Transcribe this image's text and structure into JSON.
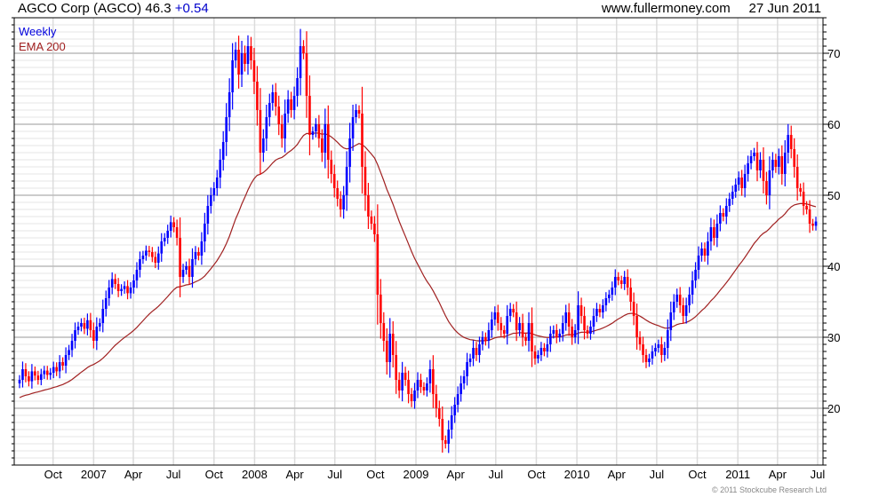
{
  "header": {
    "company": "AGCO Corp (AGCO)",
    "price": "46.3",
    "change": "+0.54",
    "site": "www.fullermoney.com",
    "date": "27 Jun 2011"
  },
  "legend": {
    "weekly": "Weekly",
    "ema": "EMA 200"
  },
  "copyright": "© 2011 Stockcube Research Ltd",
  "colors": {
    "up": "#0000ff",
    "down": "#ff0000",
    "ema": "#a02020",
    "grid_major": "#bbbbbb",
    "grid_minor": "#e4e4e4"
  },
  "chart_data": {
    "type": "candlestick",
    "frequency": "weekly",
    "first_week": "2006-07-17",
    "last_week": "2011-06-27",
    "ylim": [
      12,
      75
    ],
    "y_ticks": [
      20,
      30,
      40,
      50,
      60,
      70
    ],
    "x_ticks": [
      "Oct",
      "2007",
      "Apr",
      "Jul",
      "Oct",
      "2008",
      "Apr",
      "Jul",
      "Oct",
      "2009",
      "Apr",
      "Jul",
      "Oct",
      "2010",
      "Apr",
      "Jul",
      "Oct",
      "2011",
      "Apr",
      "Jul"
    ],
    "x_tick_dates": [
      "2006-10",
      "2007-01",
      "2007-04",
      "2007-07",
      "2007-10",
      "2008-01",
      "2008-04",
      "2008-07",
      "2008-10",
      "2009-01",
      "2009-04",
      "2009-07",
      "2009-10",
      "2010-01",
      "2010-04",
      "2010-07",
      "2010-10",
      "2011-01",
      "2011-04",
      "2011-07"
    ],
    "grid": true,
    "legend_position": "top-left",
    "ema_period": 200,
    "ema_start": 21.5,
    "closes": [
      24.0,
      25.5,
      24.5,
      23.8,
      25.2,
      24.6,
      24.0,
      24.8,
      25.3,
      24.7,
      25.0,
      25.8,
      25.2,
      26.5,
      26.0,
      27.5,
      28.2,
      29.5,
      31.0,
      31.5,
      32.0,
      31.2,
      32.4,
      31.0,
      29.5,
      31.5,
      32.0,
      34.0,
      35.5,
      37.0,
      38.2,
      37.5,
      36.5,
      36.8,
      37.2,
      36.2,
      37.0,
      38.0,
      39.5,
      41.0,
      41.5,
      42.2,
      42.0,
      41.3,
      40.5,
      41.8,
      43.5,
      44.0,
      45.0,
      46.2,
      45.5,
      44.0,
      38.5,
      39.5,
      40.0,
      38.5,
      41.0,
      42.0,
      41.5,
      43.5,
      46.0,
      48.5,
      50.0,
      51.0,
      52.5,
      55.0,
      57.5,
      61.0,
      64.5,
      69.0,
      70.5,
      67.0,
      70.0,
      68.5,
      71.0,
      69.0,
      66.0,
      62.0,
      56.0,
      58.0,
      61.0,
      63.0,
      64.5,
      62.5,
      60.0,
      58.0,
      61.5,
      63.5,
      62.0,
      64.0,
      66.5,
      71.0,
      70.0,
      64.0,
      58.5,
      59.0,
      60.0,
      58.0,
      56.0,
      60.0,
      55.0,
      53.0,
      51.0,
      49.5,
      48.0,
      50.0,
      54.0,
      58.0,
      61.0,
      62.0,
      61.5,
      54.0,
      50.0,
      47.0,
      46.0,
      44.5,
      36.0,
      32.0,
      29.5,
      26.5,
      30.5,
      27.5,
      24.0,
      22.5,
      25.0,
      24.0,
      22.0,
      21.0,
      22.5,
      24.0,
      23.0,
      22.5,
      23.5,
      25.5,
      22.0,
      20.0,
      18.5,
      15.5,
      15.0,
      17.0,
      19.0,
      20.5,
      22.0,
      23.5,
      24.5,
      26.5,
      27.0,
      28.5,
      27.5,
      29.0,
      30.0,
      29.5,
      31.0,
      32.5,
      33.5,
      32.0,
      31.0,
      30.5,
      33.0,
      34.0,
      33.5,
      31.0,
      32.0,
      30.0,
      29.5,
      32.0,
      28.0,
      27.0,
      27.5,
      28.5,
      28.0,
      29.0,
      30.5,
      31.0,
      30.0,
      30.5,
      32.0,
      33.5,
      31.5,
      30.0,
      31.0,
      34.5,
      33.0,
      31.0,
      30.5,
      31.5,
      33.0,
      34.0,
      33.5,
      34.5,
      35.5,
      36.0,
      37.0,
      38.5,
      38.0,
      37.5,
      38.5,
      37.0,
      35.0,
      33.0,
      30.0,
      29.0,
      27.5,
      26.5,
      27.0,
      28.0,
      28.5,
      29.0,
      27.5,
      28.5,
      31.0,
      33.5,
      35.0,
      36.0,
      34.5,
      33.0,
      34.5,
      36.0,
      38.0,
      39.5,
      41.5,
      42.5,
      41.5,
      43.5,
      45.5,
      44.0,
      46.0,
      47.5,
      47.0,
      48.5,
      49.5,
      50.5,
      51.5,
      52.5,
      51.0,
      53.0,
      54.5,
      55.5,
      56.0,
      53.5,
      55.0,
      52.0,
      50.0,
      53.5,
      55.0,
      54.0,
      55.5,
      53.0,
      56.0,
      58.5,
      56.5,
      54.0,
      51.0,
      50.5,
      48.5,
      48.0,
      46.0,
      45.7,
      46.3
    ]
  }
}
